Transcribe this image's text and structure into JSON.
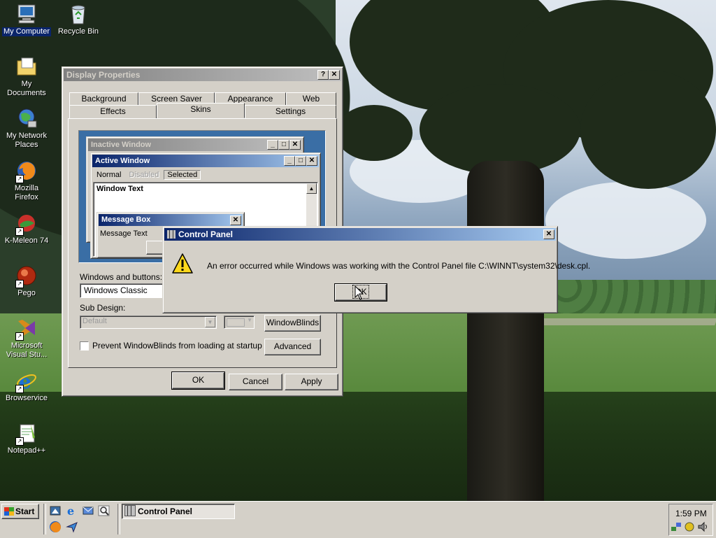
{
  "desktop": {
    "icons": [
      {
        "label": "My Computer"
      },
      {
        "label": "Recycle Bin"
      },
      {
        "label": "My Documents"
      },
      {
        "label": "My Network Places"
      },
      {
        "label": "Mozilla Firefox"
      },
      {
        "label": "K-Meleon 74"
      },
      {
        "label": "Pego"
      },
      {
        "label": "Microsoft Visual Stu..."
      },
      {
        "label": "Browservice"
      },
      {
        "label": "Notepad++"
      }
    ]
  },
  "display_properties": {
    "title": "Display Properties",
    "tabs_row1": [
      "Background",
      "Screen Saver",
      "Appearance",
      "Web"
    ],
    "tabs_row2": [
      "Effects",
      "Skins",
      "Settings"
    ],
    "selected_tab": "Skins",
    "preview": {
      "inactive_title": "Inactive Window",
      "active_title": "Active Window",
      "menu_normal": "Normal",
      "menu_disabled": "Disabled",
      "menu_selected": "Selected",
      "window_text": "Window Text",
      "msgbox_title": "Message Box",
      "msgbox_text": "Message Text"
    },
    "windows_buttons_label": "Windows and buttons:",
    "windows_buttons_value": "Windows Classic",
    "sub_design_label": "Sub Design:",
    "sub_design_value": "Default",
    "windowblinds_button": "WindowBlinds",
    "checkbox_label": "Prevent WindowBlinds from loading at startup",
    "advanced_button": "Advanced",
    "ok_button": "OK",
    "cancel_button": "Cancel",
    "apply_button": "Apply"
  },
  "error_dialog": {
    "title": "Control Panel",
    "message": "An error occurred while Windows was working with the Control Panel file C:\\WINNT\\system32\\desk.cpl.",
    "ok_button": "OK"
  },
  "taskbar": {
    "start_label": "Start",
    "task_label": "Control Panel",
    "clock": "1:59 PM"
  }
}
